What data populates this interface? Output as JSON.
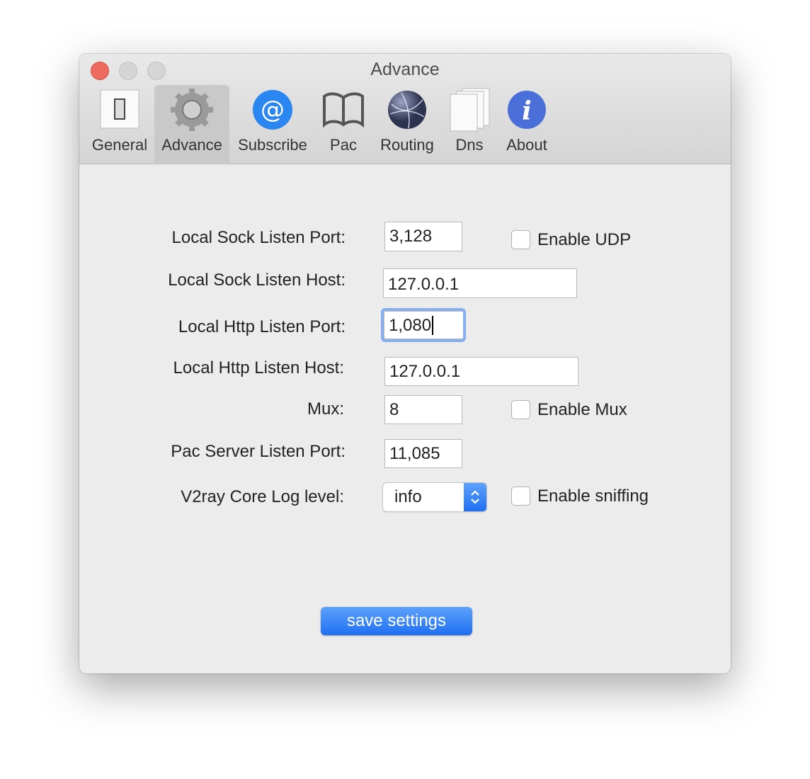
{
  "window": {
    "title": "Advance"
  },
  "toolbar": {
    "items": [
      {
        "label": "General",
        "icon": "switch-icon"
      },
      {
        "label": "Advance",
        "icon": "gear-icon",
        "selected": true
      },
      {
        "label": "Subscribe",
        "icon": "at-icon"
      },
      {
        "label": "Pac",
        "icon": "book-icon"
      },
      {
        "label": "Routing",
        "icon": "globe-network-icon"
      },
      {
        "label": "Dns",
        "icon": "documents-icon"
      },
      {
        "label": "About",
        "icon": "info-icon"
      }
    ]
  },
  "form": {
    "sock_port": {
      "label": "Local Sock Listen Port:",
      "value": "3,128"
    },
    "sock_host": {
      "label": "Local Sock Listen Host:",
      "value": "127.0.0.1"
    },
    "http_port": {
      "label": "Local Http Listen Port:",
      "value": "1,080"
    },
    "http_host": {
      "label": "Local Http Listen Host:",
      "value": "127.0.0.1"
    },
    "mux": {
      "label": "Mux:",
      "value": "8"
    },
    "pac_port": {
      "label": "Pac Server Listen Port:",
      "value": "11,085"
    },
    "log_level": {
      "label": "V2ray Core Log level:",
      "value": "info"
    },
    "enable_udp": {
      "label": "Enable UDP",
      "checked": false
    },
    "enable_mux": {
      "label": "Enable Mux",
      "checked": false
    },
    "enable_sniffing": {
      "label": "Enable sniffing",
      "checked": false
    }
  },
  "save_label": "save settings",
  "colors": {
    "accent": "#1f6ff2",
    "close": "#ed6a5e"
  }
}
